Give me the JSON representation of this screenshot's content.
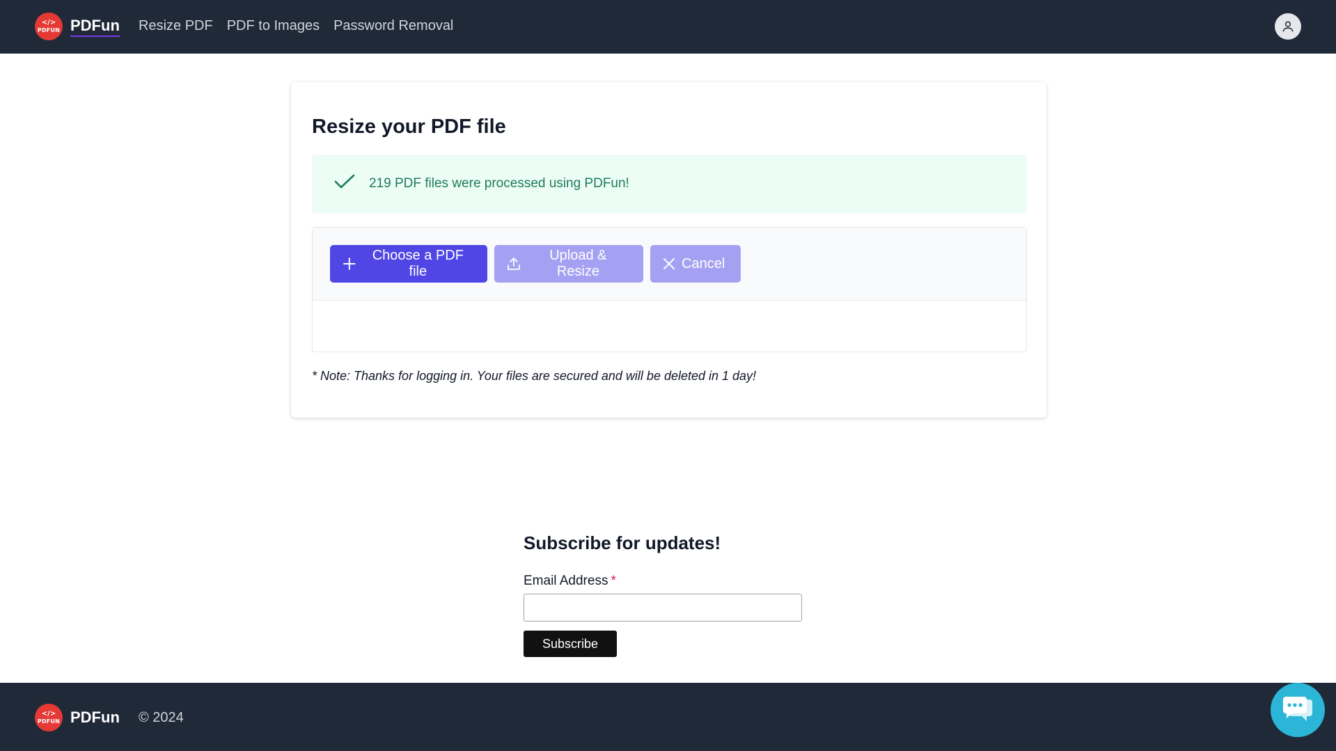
{
  "header": {
    "brand": "PDFun",
    "logo_code": "</>",
    "logo_word": "PDFUN",
    "nav": [
      {
        "label": "Resize PDF"
      },
      {
        "label": "PDF to Images"
      },
      {
        "label": "Password Removal"
      }
    ],
    "user_icon": "user-icon"
  },
  "main": {
    "title": "Resize your PDF file",
    "alert": {
      "icon": "check-icon",
      "text": "219 PDF files were processed using PDFun!"
    },
    "buttons": {
      "choose": "Choose a PDF file",
      "upload": "Upload & Resize",
      "cancel": "Cancel"
    },
    "note": "* Note: Thanks for logging in. Your files are secured and will be deleted in 1 day!"
  },
  "subscribe": {
    "title": "Subscribe for updates!",
    "email_label": "Email Address",
    "required_mark": "*",
    "email_value": "",
    "button": "Subscribe"
  },
  "footer": {
    "brand": "PDFun",
    "copyright": "© 2024"
  },
  "chat": {
    "icon": "chat-icon"
  },
  "colors": {
    "header_bg": "#1f2937",
    "primary": "#4f46e5",
    "primary_disabled": "#a5a1f2",
    "success_bg": "#ecfdf5",
    "success_text": "#1f7a5c",
    "chat": "#2bb6d8",
    "logo": "#e53935"
  }
}
